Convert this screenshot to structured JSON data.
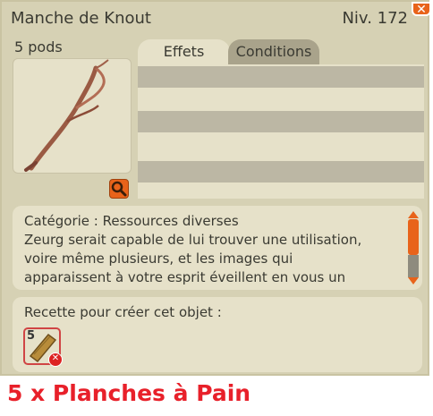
{
  "window": {
    "title": "Manche de Knout",
    "level": "Niv. 172",
    "close": "✕"
  },
  "item": {
    "weight": "5 pods",
    "icon": "knout-handle-icon"
  },
  "tabs": [
    {
      "label": "Effets"
    },
    {
      "label": "Conditions"
    }
  ],
  "description": {
    "text": "Catégorie : Ressources diverses\nZeurg serait capable de lui trouver une utilisation, voire même plusieurs, et les images qui apparaissent à votre esprit éveillent en vous un"
  },
  "recipe": {
    "label": "Recette pour créer cet objet :",
    "ingredients": [
      {
        "quantity": "5",
        "icon": "plank-icon",
        "status": "missing"
      }
    ]
  },
  "caption": "5 x Planches à Pain",
  "colors": {
    "accent": "#e8631a",
    "panel": "#d6d1b4",
    "caption": "#e8202a"
  }
}
